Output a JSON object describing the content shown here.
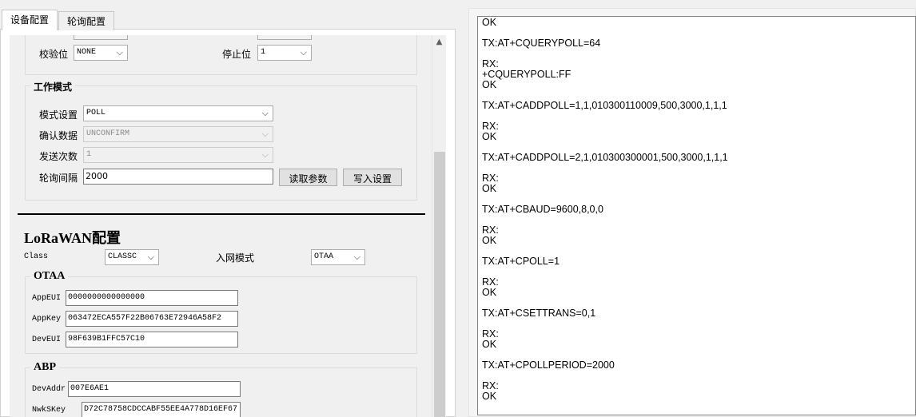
{
  "tabs": [
    {
      "label": "设备配置",
      "active": true
    },
    {
      "label": "轮询配置",
      "active": false
    }
  ],
  "serial": {
    "parity_label": "校验位",
    "parity_value": "NONE",
    "stopbit_label": "停止位",
    "stopbit_value": "1"
  },
  "work_mode": {
    "title": "工作模式",
    "mode_label": "模式设置",
    "mode_value": "POLL",
    "confirm_label": "确认数据",
    "confirm_value": "UNCONFIRM",
    "send_count_label": "发送次数",
    "send_count_value": "1",
    "poll_interval_label": "轮询间隔",
    "poll_interval_value": "2000",
    "read_button": "读取参数",
    "write_button": "写入设置"
  },
  "lorawan": {
    "title": "LoRaWAN配置",
    "class_label": "Class",
    "class_value": "CLASSC",
    "join_label": "入网模式",
    "join_value": "OTAA",
    "otaa": {
      "title": "OTAA",
      "appeui_label": "AppEUI",
      "appeui_value": "0000000000000000",
      "appkey_label": "AppKey",
      "appkey_value": "063472ECA557F22B06763E72946A58F2",
      "deveui_label": "DevEUI",
      "deveui_value": "98F639B1FFC57C10"
    },
    "abp": {
      "title": "ABP",
      "devaddr_label": "DevAddr",
      "devaddr_value": "007E6AE1",
      "nwkskey_label": "NwkSKey",
      "nwkskey_value": "D72C78758CDCCABF55EE4A778D16EF67"
    }
  },
  "log": {
    "lines": [
      "OK",
      "TX:AT+CQUERYPOLL=64",
      "RX:",
      "+CQUERYPOLL:FF",
      "OK",
      "TX:AT+CADDPOLL=1,1,010300110009,500,3000,1,1,1",
      "RX:",
      "OK",
      "TX:AT+CADDPOLL=2,1,010300300001,500,3000,1,1,1",
      "RX:",
      "OK",
      "TX:AT+CBAUD=9600,8,0,0",
      "RX:",
      "OK",
      "TX:AT+CPOLL=1",
      "RX:",
      "OK",
      "TX:AT+CSETTRANS=0,1",
      "RX:",
      "OK",
      "TX:AT+CPOLLPERIOD=2000",
      "RX:",
      "OK"
    ]
  }
}
